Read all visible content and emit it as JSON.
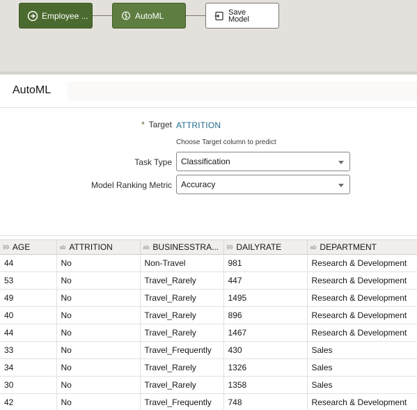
{
  "workflow": {
    "nodes": [
      {
        "label": "Employee ...",
        "icon": "arrow-right-circle-icon",
        "state": "active"
      },
      {
        "label": "AutoML",
        "icon": "brain-icon",
        "state": "active"
      },
      {
        "label": "Save Model",
        "icon": "save-box-icon",
        "state": "idle"
      }
    ]
  },
  "panel": {
    "title": "AutoML"
  },
  "form": {
    "target_label": "Target",
    "target_required_mark": "*",
    "target_value": "ATTRITION",
    "target_helper": "Choose Target column to predict",
    "task_type_label": "Task Type",
    "task_type_value": "Classification",
    "ranking_metric_label": "Model Ranking Metric",
    "ranking_metric_value": "Accuracy"
  },
  "table": {
    "columns": [
      {
        "type": "99",
        "name": "AGE"
      },
      {
        "type": "ab",
        "name": "ATTRITION"
      },
      {
        "type": "ab",
        "name": "BUSINESSTRA..."
      },
      {
        "type": "99",
        "name": "DAILYRATE"
      },
      {
        "type": "ab",
        "name": "DEPARTMENT"
      }
    ],
    "rows": [
      [
        "44",
        "No",
        "Non-Travel",
        "981",
        "Research & Development"
      ],
      [
        "53",
        "No",
        "Travel_Rarely",
        "447",
        "Research & Development"
      ],
      [
        "49",
        "No",
        "Travel_Rarely",
        "1495",
        "Research & Development"
      ],
      [
        "40",
        "No",
        "Travel_Rarely",
        "896",
        "Research & Development"
      ],
      [
        "44",
        "No",
        "Travel_Rarely",
        "1467",
        "Research & Development"
      ],
      [
        "33",
        "No",
        "Travel_Frequently",
        "430",
        "Sales"
      ],
      [
        "34",
        "No",
        "Travel_Rarely",
        "1326",
        "Sales"
      ],
      [
        "30",
        "No",
        "Travel_Rarely",
        "1358",
        "Sales"
      ],
      [
        "42",
        "No",
        "Travel_Frequently",
        "748",
        "Research & Development"
      ]
    ]
  },
  "colors": {
    "node_active": "#4b6a2f",
    "link": "#1f6a8f",
    "canvas": "#e4e1dd"
  }
}
